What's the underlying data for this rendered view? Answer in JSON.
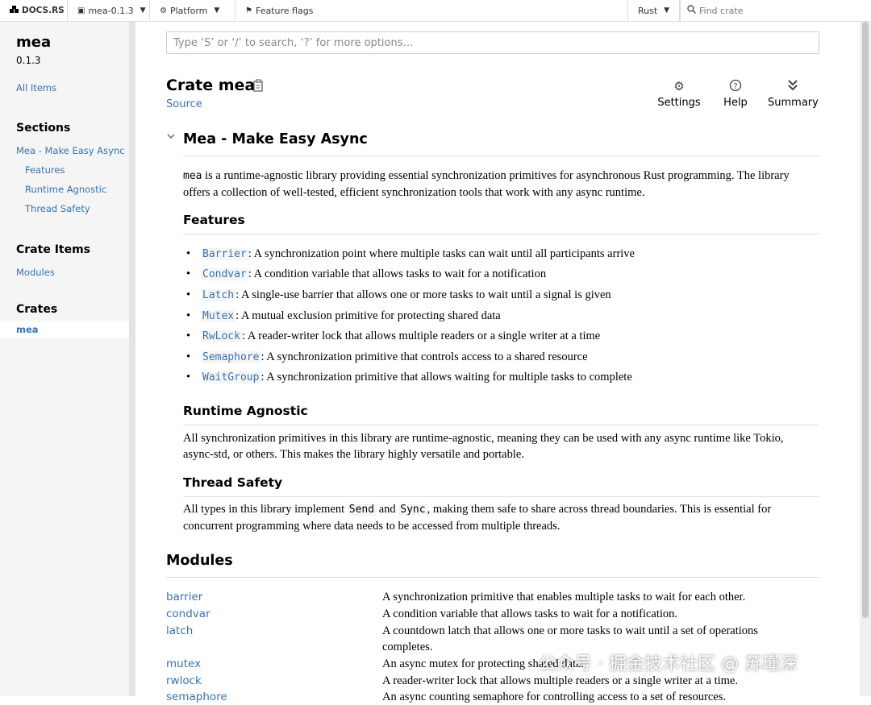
{
  "topnav": {
    "logo_label": "DOCS.RS",
    "version_label": "mea-0.1.3",
    "platform_label": "Platform",
    "feature_flags_label": "Feature flags",
    "rust_label": "Rust",
    "find_placeholder": "Find crate"
  },
  "sidebar": {
    "crate_name": "mea",
    "version": "0.1.3",
    "all_items": "All Items",
    "sections_heading": "Sections",
    "sections": [
      "Mea - Make Easy Async",
      "Features",
      "Runtime Agnostic",
      "Thread Safety"
    ],
    "crate_items_heading": "Crate Items",
    "crate_items": [
      "Modules"
    ],
    "crates_heading": "Crates",
    "crates": [
      "mea"
    ]
  },
  "main": {
    "search_placeholder": "Type ‘S’ or ‘/’ to search, ‘?’ for more options…",
    "crate_title": "Crate mea",
    "source_link": "Source",
    "toolbar": {
      "settings": "Settings",
      "help": "Help",
      "summary": "Summary"
    },
    "doc_heading": "Mea - Make Easy Async",
    "intro_code": "mea",
    "intro_text": " is a runtime-agnostic library providing essential synchronization primitives for asynchronous Rust programming. The library offers a collection of well-tested, efficient synchronization tools that work with any async runtime.",
    "features_heading": "Features",
    "features": [
      {
        "name": "Barrier",
        "desc": ": A synchronization point where multiple tasks can wait until all participants arrive"
      },
      {
        "name": "Condvar",
        "desc": ": A condition variable that allows tasks to wait for a notification"
      },
      {
        "name": "Latch",
        "desc": ": A single-use barrier that allows one or more tasks to wait until a signal is given"
      },
      {
        "name": "Mutex",
        "desc": ": A mutual exclusion primitive for protecting shared data"
      },
      {
        "name": "RwLock",
        "desc": ": A reader-writer lock that allows multiple readers or a single writer at a time"
      },
      {
        "name": "Semaphore",
        "desc": ": A synchronization primitive that controls access to a shared resource"
      },
      {
        "name": "WaitGroup",
        "desc": ": A synchronization primitive that allows waiting for multiple tasks to complete"
      }
    ],
    "runtime_heading": "Runtime Agnostic",
    "runtime_text": "All synchronization primitives in this library are runtime-agnostic, meaning they can be used with any async runtime like Tokio, async-std, or others. This makes the library highly versatile and portable.",
    "thread_heading": "Thread Safety",
    "thread_text_1": "All types in this library implement ",
    "thread_code_1": "Send",
    "thread_text_2": " and ",
    "thread_code_2": "Sync",
    "thread_text_3": ", making them safe to share across thread boundaries. This is essential for concurrent programming where data needs to be accessed from multiple threads.",
    "modules_heading": "Modules",
    "modules": [
      {
        "name": "barrier",
        "desc": "A synchronization primitive that enables multiple tasks to wait for each other."
      },
      {
        "name": "condvar",
        "desc": "A condition variable that allows tasks to wait for a notification."
      },
      {
        "name": "latch",
        "desc": "A countdown latch that allows one or more tasks to wait until a set of operations completes."
      },
      {
        "name": "mutex",
        "desc": "An async mutex for protecting shared data."
      },
      {
        "name": "rwlock",
        "desc": "A reader-writer lock that allows multiple readers or a single writer at a time."
      },
      {
        "name": "semaphore",
        "desc": "An async counting semaphore for controlling access to a set of resources."
      }
    ]
  },
  "watermark": "公众号 · 掘金技术社区 @ 苏瑾深",
  "icons": {
    "logo": "cubes-icon",
    "version": "cube-icon",
    "platform": "gear-icon",
    "flags": "flag-icon",
    "find": "search-icon"
  }
}
